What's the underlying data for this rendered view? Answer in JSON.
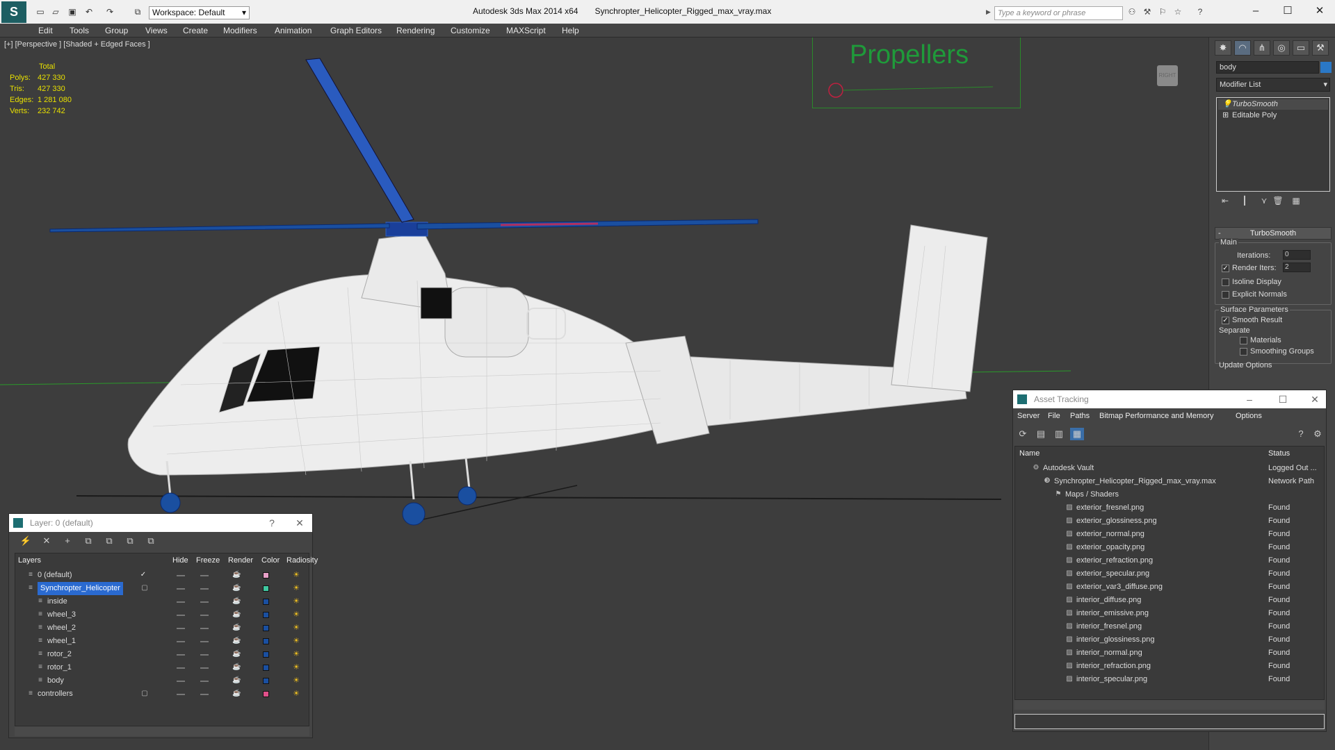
{
  "titlebar": {
    "workspace": "Workspace: Default",
    "app_title": "Autodesk 3ds Max  2014 x64",
    "file_title": "Synchropter_Helicopter_Rigged_max_vray.max",
    "search_placeholder": "Type a keyword or phrase"
  },
  "menu": [
    "Edit",
    "Tools",
    "Group",
    "Views",
    "Create",
    "Modifiers",
    "Animation",
    "Graph Editors",
    "Rendering",
    "Customize",
    "MAXScript",
    "Help"
  ],
  "viewport": {
    "label": "[+] [Perspective ] [Shaded + Edged Faces ]",
    "stats_header": "Total",
    "stats": [
      {
        "label": "Polys:",
        "value": "427 330"
      },
      {
        "label": "Tris:",
        "value": "427 330"
      },
      {
        "label": "Edges:",
        "value": "1 281 080"
      },
      {
        "label": "Verts:",
        "value": "232 742"
      }
    ],
    "propellers_label": "Propellers",
    "viewcube_label": "RIGHT"
  },
  "command_panel": {
    "object_name": "body",
    "object_color": "#2a78c6",
    "modifier_list": "Modifier List",
    "stack": [
      "TurboSmooth",
      "Editable Poly"
    ],
    "rollout_title": "TurboSmooth",
    "main_group": "Main",
    "iterations_label": "Iterations:",
    "iterations_value": "0",
    "render_iters_label": "Render Iters:",
    "render_iters_value": "2",
    "render_iters_checked": true,
    "isoline_label": "Isoline Display",
    "explicit_normals_label": "Explicit Normals",
    "surface_params_label": "Surface Parameters",
    "smooth_result_label": "Smooth Result",
    "smooth_result_checked": true,
    "separate_label": "Separate",
    "materials_label": "Materials",
    "smoothing_groups_label": "Smoothing Groups",
    "update_options_label": "Update Options"
  },
  "layer_window": {
    "title": "Layer: 0 (default)",
    "help": "?",
    "columns": [
      "Layers",
      "Hide",
      "Freeze",
      "Render",
      "Color",
      "Radiosity"
    ],
    "rows": [
      {
        "name": "0 (default)",
        "indent": 0,
        "color": "#e8a0c8",
        "selected": false,
        "active": true
      },
      {
        "name": "Synchropter_Helicopter",
        "indent": 0,
        "color": "#40c8a0",
        "selected": true,
        "active": false
      },
      {
        "name": "inside",
        "indent": 1,
        "color": "#1a4fa0",
        "selected": false,
        "active": false
      },
      {
        "name": "wheel_3",
        "indent": 1,
        "color": "#1a4fa0",
        "selected": false,
        "active": false
      },
      {
        "name": "wheel_2",
        "indent": 1,
        "color": "#1a4fa0",
        "selected": false,
        "active": false
      },
      {
        "name": "wheel_1",
        "indent": 1,
        "color": "#1a4fa0",
        "selected": false,
        "active": false
      },
      {
        "name": "rotor_2",
        "indent": 1,
        "color": "#1a4fa0",
        "selected": false,
        "active": false
      },
      {
        "name": "rotor_1",
        "indent": 1,
        "color": "#1a4fa0",
        "selected": false,
        "active": false
      },
      {
        "name": "body",
        "indent": 1,
        "color": "#1a4fa0",
        "selected": false,
        "active": false
      },
      {
        "name": "controllers",
        "indent": 0,
        "color": "#e0508a",
        "selected": false,
        "active": false
      }
    ]
  },
  "asset_window": {
    "title": "Asset Tracking",
    "menus": [
      "Server",
      "File",
      "Paths",
      "Bitmap Performance and Memory",
      "Options"
    ],
    "col_name": "Name",
    "col_status": "Status",
    "rows": [
      {
        "name": "Autodesk Vault",
        "status": "Logged Out ...",
        "indent": 0
      },
      {
        "name": "Synchropter_Helicopter_Rigged_max_vray.max",
        "status": "Network Path",
        "indent": 1
      },
      {
        "name": "Maps / Shaders",
        "status": "",
        "indent": 2
      },
      {
        "name": "exterior_fresnel.png",
        "status": "Found",
        "indent": 3
      },
      {
        "name": "exterior_glossiness.png",
        "status": "Found",
        "indent": 3
      },
      {
        "name": "exterior_normal.png",
        "status": "Found",
        "indent": 3
      },
      {
        "name": "exterior_opacity.png",
        "status": "Found",
        "indent": 3
      },
      {
        "name": "exterior_refraction.png",
        "status": "Found",
        "indent": 3
      },
      {
        "name": "exterior_specular.png",
        "status": "Found",
        "indent": 3
      },
      {
        "name": "exterior_var3_diffuse.png",
        "status": "Found",
        "indent": 3
      },
      {
        "name": "interior_diffuse.png",
        "status": "Found",
        "indent": 3
      },
      {
        "name": "interior_emissive.png",
        "status": "Found",
        "indent": 3
      },
      {
        "name": "interior_fresnel.png",
        "status": "Found",
        "indent": 3
      },
      {
        "name": "interior_glossiness.png",
        "status": "Found",
        "indent": 3
      },
      {
        "name": "interior_normal.png",
        "status": "Found",
        "indent": 3
      },
      {
        "name": "interior_refraction.png",
        "status": "Found",
        "indent": 3
      },
      {
        "name": "interior_specular.png",
        "status": "Found",
        "indent": 3
      }
    ]
  }
}
